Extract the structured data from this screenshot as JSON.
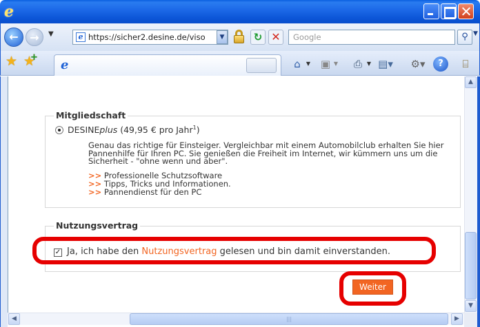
{
  "browser": {
    "address_url": "https://sicher2.desine.de/viso",
    "search_placeholder": "Google",
    "window_icon": "e",
    "tab_icon": "e"
  },
  "icons": [
    "back-arrow-icon",
    "forward-arrow-icon",
    "lock-icon",
    "refresh-icon",
    "stop-icon",
    "search-icon",
    "favorites-star-icon",
    "add-favorites-icon",
    "home-icon",
    "feeds-icon",
    "print-icon",
    "page-icon",
    "tools-icon",
    "help-icon",
    "research-icon"
  ],
  "membership": {
    "legend": "Mitgliedschaft",
    "plan_name": "DESINE",
    "plan_suffix": "plus",
    "plan_price": " (49,95 € pro Jahr",
    "plan_footnote": "1",
    "plan_close": ")",
    "description": "Genau das richtige für Einsteiger. Vergleichbar mit einem Automobilclub erhalten Sie hier Pannenhilfe für Ihren PC. Sie genießen die Freiheit im Internet, wir kümmern uns um die Sicherheit - \"ohne wenn und aber\".",
    "features": [
      {
        "arrow": ">>",
        "text": " Professionelle Schutzsoftware"
      },
      {
        "arrow": ">>",
        "text": " Tipps, Tricks und Informationen."
      },
      {
        "arrow": ">>",
        "text": " Pannendienst für den PC"
      }
    ]
  },
  "contract": {
    "legend": "Nutzungsvertrag",
    "checkbox_mark": "✓",
    "accept_prefix": "Ja, ich habe den ",
    "accept_link": "Nutzungsvertrag",
    "accept_suffix": " gelesen und bin damit einverstanden."
  },
  "next_button": "Weiter",
  "accent_color": "#f26522",
  "highlight_color": "#e60000"
}
